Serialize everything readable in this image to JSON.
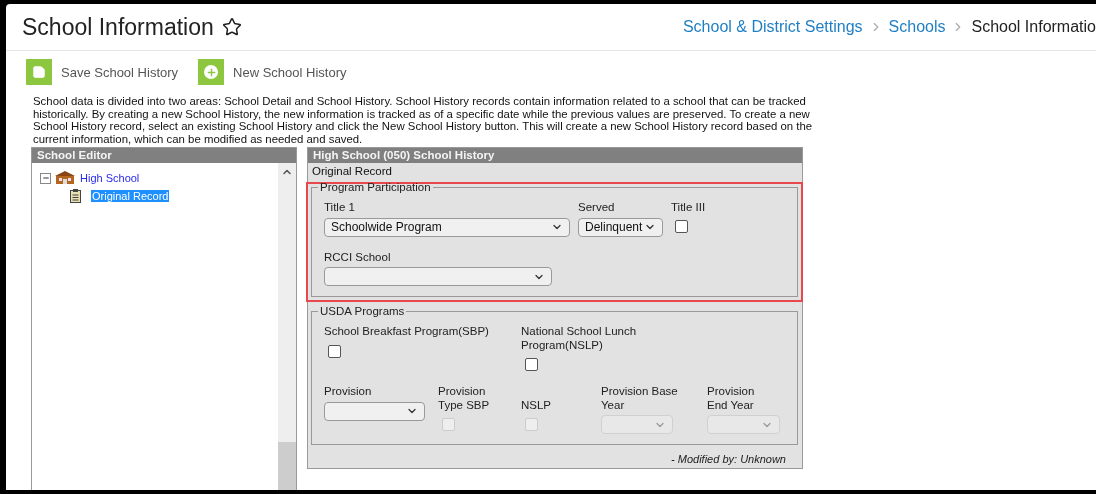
{
  "header": {
    "title": "School Information",
    "breadcrumbs": [
      {
        "label": "School & District Settings",
        "kind": "link"
      },
      {
        "label": "Schools",
        "kind": "link"
      },
      {
        "label": "School Informatio",
        "kind": "current"
      }
    ]
  },
  "toolbar": [
    {
      "label": "Save School History",
      "kind": "save"
    },
    {
      "label": "New School History",
      "kind": "new"
    }
  ],
  "description": "School data is divided into two areas: School Detail and School History. School History records contain information related to a school that can be tracked historically. By creating a new School History, the new information is tracked as of a specific date while the previous values are preserved. To create a new School History record, select an existing School History and click the New School History button. This will create a new School History record based on the current information, which can be modified as needed and saved.",
  "editor": {
    "title": "School Editor",
    "tree": [
      {
        "label": "High School",
        "kind": "school",
        "expanded": true,
        "selected": false,
        "children": [
          {
            "label": "Original Record",
            "kind": "record",
            "selected": true
          }
        ]
      }
    ]
  },
  "detail": {
    "title": "High School (050) School History",
    "subtitle": "Original Record",
    "footer": "- Modified by: Unknown",
    "sections": [
      {
        "legend": "Program Participation",
        "highlighted": true,
        "rows": [
          [
            {
              "kind": "select",
              "label": "Title 1",
              "value": "Schoolwide Program",
              "disabled": false
            },
            {
              "kind": "select",
              "label": "Served",
              "value": "Delinquent",
              "disabled": false
            },
            {
              "kind": "checkbox",
              "label": "Title III",
              "checked": false,
              "disabled": false
            }
          ],
          [
            {
              "kind": "select",
              "label": "RCCI School",
              "disabled": false
            }
          ]
        ]
      },
      {
        "legend": "USDA Programs",
        "highlighted": false,
        "rows": [
          [
            {
              "kind": "checkbox",
              "label": "School Breakfast Program(SBP)",
              "checked": false,
              "disabled": false
            },
            "",
            {
              "kind": "checkbox",
              "label": "National School Lunch Program(NSLP)",
              "checked": false,
              "disabled": false
            }
          ],
          [
            {
              "kind": "select",
              "label": "Provision",
              "disabled": false
            },
            {
              "kind": "checkbox",
              "label": "Provision Type SBP",
              "checked": false,
              "disabled": true
            },
            {
              "kind": "checkbox",
              "label": "NSLP",
              "checked": false,
              "disabled": true
            },
            {
              "kind": "select",
              "label": "Provision Base Year",
              "disabled": true
            },
            {
              "kind": "select",
              "label": "Provision End Year",
              "disabled": true
            }
          ]
        ]
      }
    ]
  }
}
